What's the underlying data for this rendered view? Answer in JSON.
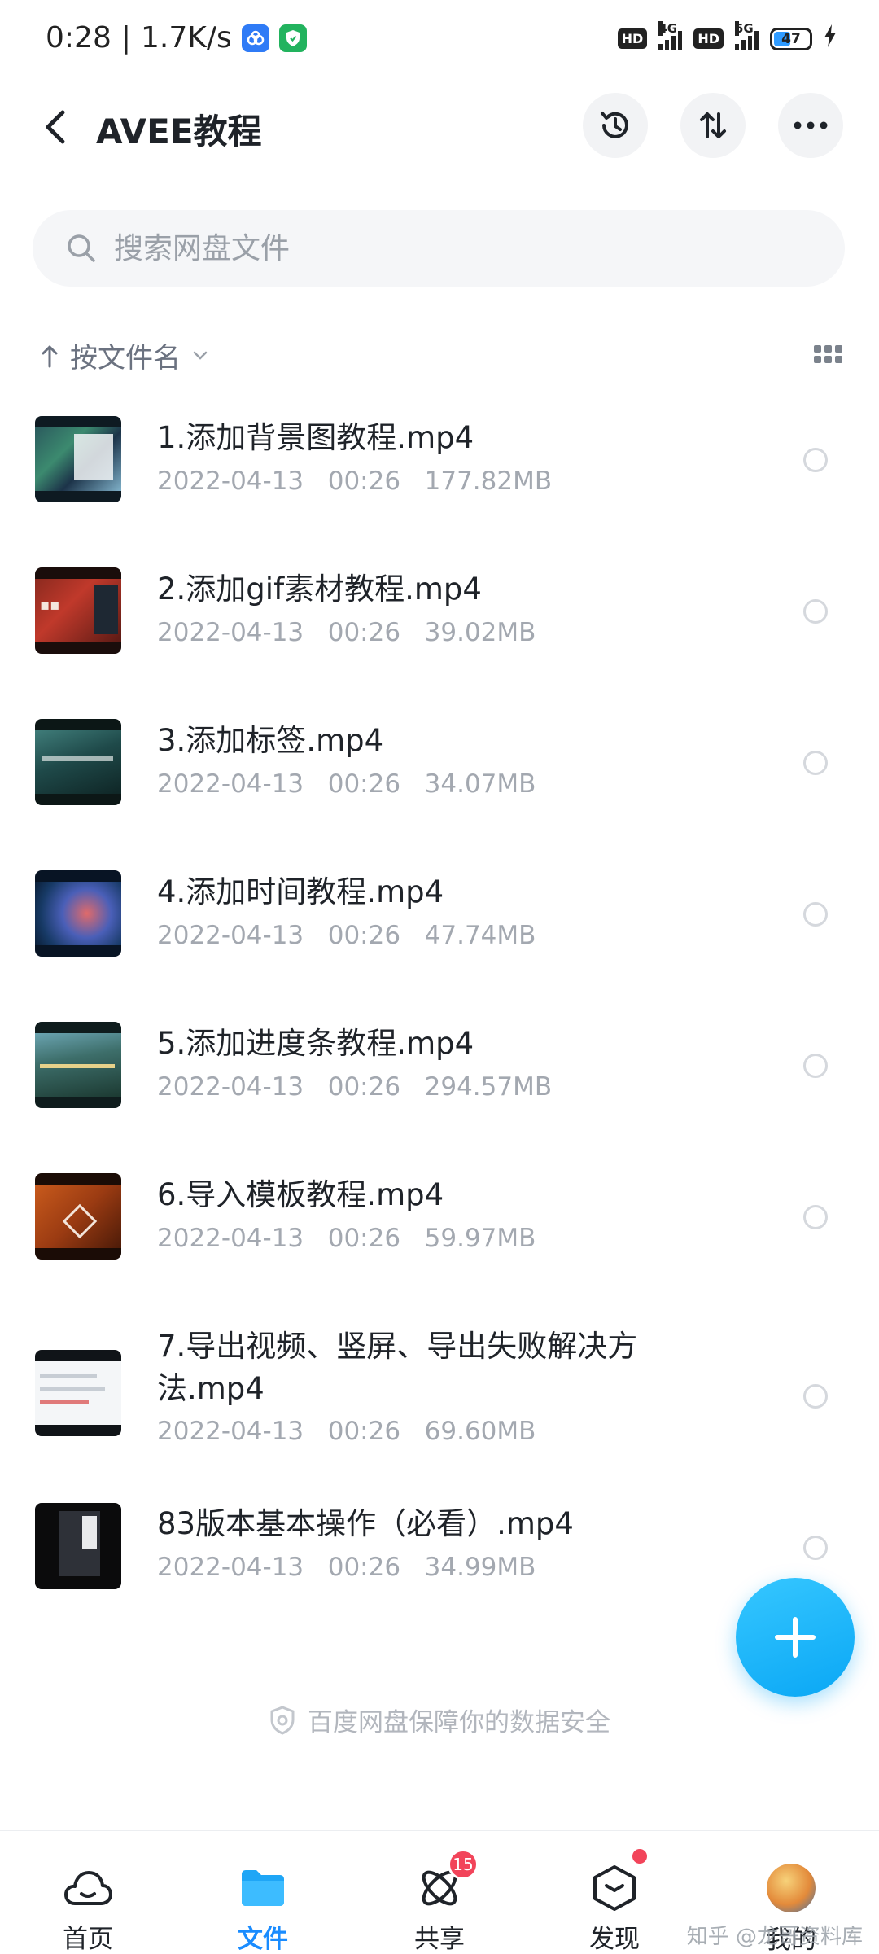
{
  "status_bar": {
    "time": "0:28",
    "speed": "1.7K/s",
    "hd1": "HD",
    "net1": "4G",
    "hd2": "HD",
    "net2": "5G",
    "battery": "47",
    "battery_level": 0.47
  },
  "header": {
    "title": "AVEE教程"
  },
  "search": {
    "placeholder": "搜索网盘文件"
  },
  "sort": {
    "label": "按文件名"
  },
  "files": [
    {
      "name": "1.添加背景图教程.mp4",
      "date": "2022-04-13",
      "time": "00:26",
      "size": "177.82MB"
    },
    {
      "name": "2.添加gif素材教程.mp4",
      "date": "2022-04-13",
      "time": "00:26",
      "size": "39.02MB"
    },
    {
      "name": "3.添加标签.mp4",
      "date": "2022-04-13",
      "time": "00:26",
      "size": "34.07MB"
    },
    {
      "name": "4.添加时间教程.mp4",
      "date": "2022-04-13",
      "time": "00:26",
      "size": "47.74MB"
    },
    {
      "name": "5.添加进度条教程.mp4",
      "date": "2022-04-13",
      "time": "00:26",
      "size": "294.57MB"
    },
    {
      "name": "6.导入模板教程.mp4",
      "date": "2022-04-13",
      "time": "00:26",
      "size": "59.97MB"
    },
    {
      "name": "7.导出视频、竖屏、导出失败解决方法.mp4",
      "date": "2022-04-13",
      "time": "00:26",
      "size": "69.60MB"
    },
    {
      "name": "83版本基本操作（必看）.mp4",
      "date": "2022-04-13",
      "time": "00:26",
      "size": "34.99MB"
    }
  ],
  "footer_note": "百度网盘保障你的数据安全",
  "nav": {
    "home": "首页",
    "files": "文件",
    "share": "共享",
    "share_badge": "15",
    "discover": "发现",
    "mine": "我的"
  },
  "watermark": "知乎 @龙哥资料库",
  "colors": {
    "accent": "#1a8cff",
    "fab": "#0aa7f5",
    "badge": "#f2445a"
  }
}
